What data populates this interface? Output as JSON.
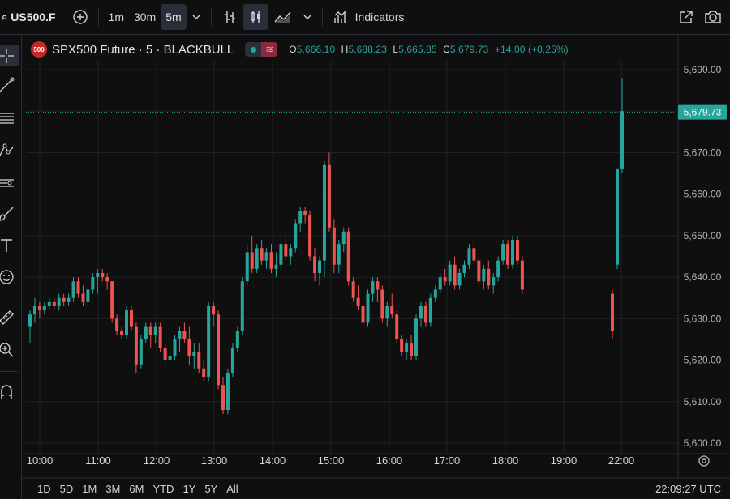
{
  "toolbar": {
    "symbol": "US500.F",
    "intervals": [
      "1m",
      "30m",
      "5m"
    ],
    "active_interval": "5m",
    "indicators_label": "Indicators"
  },
  "legend": {
    "badge": "500",
    "title": "SPX500 Future · 5 · BLACKBULL",
    "open_key": "O",
    "open": "5,666.10",
    "high_key": "H",
    "high": "5,688.23",
    "low_key": "L",
    "low": "5,665.85",
    "close_key": "C",
    "close": "5,679.73",
    "change": "+14.00 (+0.25%)"
  },
  "bottom": {
    "ranges": [
      "1D",
      "5D",
      "1M",
      "3M",
      "6M",
      "YTD",
      "1Y",
      "5Y",
      "All"
    ],
    "clock": "22:09:27 UTC"
  },
  "colors": {
    "up": "#26a69a",
    "down": "#ef5350",
    "background": "#0f0f0f",
    "grid": "#1e2128",
    "price_line": "#26a69a"
  },
  "chart_data": {
    "type": "candlestick",
    "title": "SPX500 Future · 5 · BLACKBULL",
    "last_price": 5679.73,
    "last_price_label": "5,679.73",
    "ylim": [
      5598,
      5699
    ],
    "y_ticks": [
      5600,
      5610,
      5620,
      5630,
      5640,
      5650,
      5660,
      5670,
      5680,
      5690
    ],
    "y_tick_labels": [
      "5,600.00",
      "5,610.00",
      "5,620.00",
      "5,630.00",
      "5,640.00",
      "5,650.00",
      "5,660.00",
      "5,670.00",
      "5,690.00"
    ],
    "x_ticks": [
      "10:00",
      "11:00",
      "12:00",
      "13:00",
      "14:00",
      "15:00",
      "16:00",
      "17:00",
      "18:00",
      "19:00",
      "22:00"
    ],
    "candles": [
      [
        5628,
        5632,
        5624,
        5631
      ],
      [
        5631,
        5635,
        5629,
        5633
      ],
      [
        5633,
        5634,
        5630,
        5632
      ],
      [
        5632,
        5634,
        5631,
        5633
      ],
      [
        5633,
        5635,
        5632,
        5634
      ],
      [
        5634,
        5635,
        5632,
        5633
      ],
      [
        5633,
        5636,
        5632,
        5635
      ],
      [
        5635,
        5636,
        5633,
        5634
      ],
      [
        5634,
        5636,
        5633,
        5635
      ],
      [
        5635,
        5640,
        5634,
        5639
      ],
      [
        5639,
        5640,
        5635,
        5636
      ],
      [
        5636,
        5638,
        5633,
        5634
      ],
      [
        5634,
        5638,
        5633,
        5637
      ],
      [
        5637,
        5641,
        5636,
        5640
      ],
      [
        5640,
        5642,
        5636,
        5641
      ],
      [
        5641,
        5642,
        5639,
        5640
      ],
      [
        5640,
        5641,
        5637,
        5639
      ],
      [
        5639,
        5639,
        5629,
        5630
      ],
      [
        5630,
        5631,
        5626,
        5627
      ],
      [
        5627,
        5628,
        5625,
        5626
      ],
      [
        5626,
        5633,
        5625,
        5632
      ],
      [
        5632,
        5633,
        5627,
        5628
      ],
      [
        5628,
        5629,
        5617,
        5619
      ],
      [
        5619,
        5626,
        5618,
        5625
      ],
      [
        5625,
        5629,
        5624,
        5628
      ],
      [
        5628,
        5629,
        5623,
        5626
      ],
      [
        5626,
        5629,
        5624,
        5628
      ],
      [
        5628,
        5629,
        5622,
        5623
      ],
      [
        5623,
        5624,
        5619,
        5620
      ],
      [
        5620,
        5624,
        5619,
        5621
      ],
      [
        5621,
        5626,
        5620,
        5625
      ],
      [
        5625,
        5628,
        5622,
        5627
      ],
      [
        5627,
        5629,
        5624,
        5625
      ],
      [
        5625,
        5628,
        5619,
        5621
      ],
      [
        5621,
        5624,
        5618,
        5622
      ],
      [
        5622,
        5624,
        5617,
        5618
      ],
      [
        5618,
        5620,
        5615,
        5616
      ],
      [
        5616,
        5634,
        5615,
        5633
      ],
      [
        5633,
        5634,
        5628,
        5631
      ],
      [
        5631,
        5632,
        5613,
        5614
      ],
      [
        5614,
        5616,
        5607,
        5608
      ],
      [
        5608,
        5618,
        5607,
        5617
      ],
      [
        5617,
        5624,
        5616,
        5623
      ],
      [
        5623,
        5628,
        5622,
        5627
      ],
      [
        5627,
        5640,
        5626,
        5639
      ],
      [
        5639,
        5648,
        5638,
        5646
      ],
      [
        5646,
        5650,
        5641,
        5642
      ],
      [
        5642,
        5648,
        5641,
        5647
      ],
      [
        5647,
        5649,
        5643,
        5644
      ],
      [
        5644,
        5647,
        5642,
        5646
      ],
      [
        5646,
        5648,
        5641,
        5642
      ],
      [
        5642,
        5646,
        5640,
        5643
      ],
      [
        5643,
        5649,
        5642,
        5648
      ],
      [
        5648,
        5650,
        5644,
        5645
      ],
      [
        5645,
        5648,
        5643,
        5647
      ],
      [
        5647,
        5654,
        5646,
        5653
      ],
      [
        5653,
        5657,
        5651,
        5656
      ],
      [
        5656,
        5657,
        5653,
        5655
      ],
      [
        5655,
        5656,
        5644,
        5645
      ],
      [
        5645,
        5647,
        5639,
        5641
      ],
      [
        5641,
        5645,
        5638,
        5644
      ],
      [
        5644,
        5668,
        5640,
        5667
      ],
      [
        5667,
        5670,
        5651,
        5652
      ],
      [
        5652,
        5654,
        5641,
        5643
      ],
      [
        5643,
        5649,
        5641,
        5648
      ],
      [
        5648,
        5652,
        5646,
        5651
      ],
      [
        5651,
        5652,
        5638,
        5639
      ],
      [
        5639,
        5640,
        5634,
        5635
      ],
      [
        5635,
        5638,
        5632,
        5633
      ],
      [
        5633,
        5634,
        5628,
        5629
      ],
      [
        5629,
        5637,
        5628,
        5636
      ],
      [
        5636,
        5640,
        5634,
        5639
      ],
      [
        5639,
        5640,
        5634,
        5637
      ],
      [
        5637,
        5638,
        5629,
        5630
      ],
      [
        5630,
        5634,
        5628,
        5633
      ],
      [
        5633,
        5636,
        5630,
        5631
      ],
      [
        5631,
        5632,
        5624,
        5625
      ],
      [
        5625,
        5626,
        5621,
        5622
      ],
      [
        5622,
        5625,
        5620,
        5624
      ],
      [
        5624,
        5626,
        5620,
        5621
      ],
      [
        5621,
        5631,
        5620,
        5630
      ],
      [
        5630,
        5634,
        5628,
        5633
      ],
      [
        5633,
        5634,
        5628,
        5629
      ],
      [
        5629,
        5636,
        5628,
        5635
      ],
      [
        5635,
        5638,
        5634,
        5637
      ],
      [
        5637,
        5641,
        5636,
        5640
      ],
      [
        5640,
        5642,
        5638,
        5639
      ],
      [
        5639,
        5644,
        5638,
        5643
      ],
      [
        5643,
        5645,
        5637,
        5638
      ],
      [
        5638,
        5642,
        5637,
        5641
      ],
      [
        5641,
        5644,
        5640,
        5643
      ],
      [
        5643,
        5648,
        5642,
        5647
      ],
      [
        5647,
        5649,
        5643,
        5644
      ],
      [
        5644,
        5645,
        5638,
        5639
      ],
      [
        5639,
        5643,
        5637,
        5642
      ],
      [
        5642,
        5644,
        5637,
        5638
      ],
      [
        5638,
        5641,
        5636,
        5640
      ],
      [
        5640,
        5645,
        5639,
        5644
      ],
      [
        5644,
        5649,
        5643,
        5648
      ],
      [
        5648,
        5649,
        5642,
        5643
      ],
      [
        5643,
        5650,
        5642,
        5649
      ],
      [
        5649,
        5650,
        5643,
        5644
      ],
      [
        5644,
        5645,
        5636,
        5637
      ],
      [
        5636,
        5637,
        5625,
        5627
      ],
      [
        5643,
        5666,
        5642,
        5666
      ],
      [
        5666,
        5688,
        5665,
        5680
      ]
    ]
  }
}
